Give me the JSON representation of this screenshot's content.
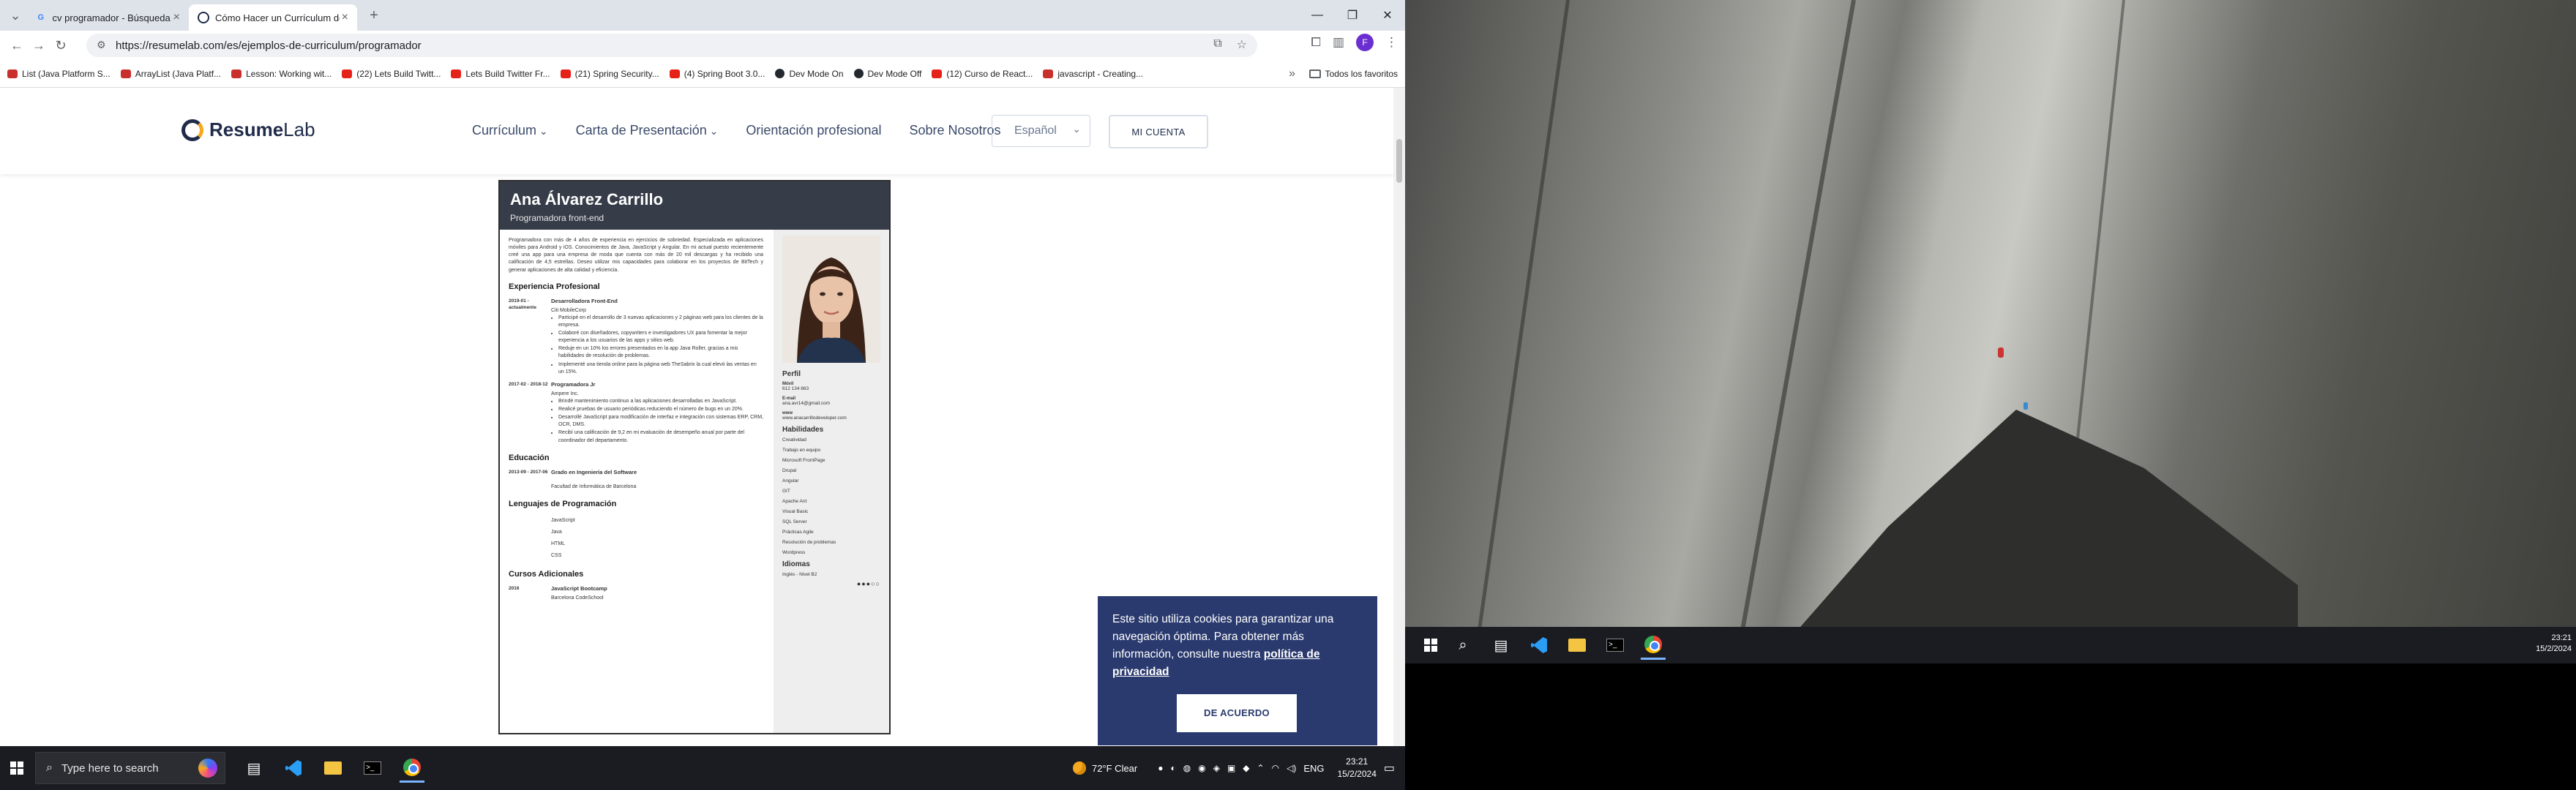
{
  "browser": {
    "tabs": [
      {
        "label": "cv programador - Búsqueda de",
        "active": false,
        "favicon": "google"
      },
      {
        "label": "Cómo Hacer un Currículum de",
        "active": true,
        "favicon": "resumelab"
      }
    ],
    "url": "https://resumelab.com/es/ejemplos-de-curriculum/programador",
    "avatar_letter": "F",
    "bookmarks": [
      {
        "label": "List (Java Platform S...",
        "icon": "doc"
      },
      {
        "label": "ArrayList (Java Platf...",
        "icon": "doc"
      },
      {
        "label": "Lesson: Working wit...",
        "icon": "doc"
      },
      {
        "label": "(22) Lets Build Twitt...",
        "icon": "yt"
      },
      {
        "label": "Lets Build Twitter Fr...",
        "icon": "yt"
      },
      {
        "label": "(21) Spring Security...",
        "icon": "yt"
      },
      {
        "label": "(4) Spring Boot 3.0...",
        "icon": "yt"
      },
      {
        "label": "Dev Mode On",
        "icon": "gh"
      },
      {
        "label": "Dev Mode Off",
        "icon": "gh"
      },
      {
        "label": "(12) Curso de React...",
        "icon": "yt"
      },
      {
        "label": "javascript - Creating...",
        "icon": "doc"
      }
    ],
    "all_bookmarks": "Todos los favoritos"
  },
  "site": {
    "logo_resume": "Resume",
    "logo_lab": "Lab",
    "nav": [
      "Currículum",
      "Carta de Presentación",
      "Orientación profesional",
      "Sobre Nosotros"
    ],
    "language": "Español",
    "account_button": "MI CUENTA"
  },
  "resume": {
    "name": "Ana Álvarez Carrillo",
    "role": "Programadora front-end",
    "summary": "Programadora con más de 4 años de experiencia en ejercicios de sobriedad. Especializada en aplicaciones móviles para Android y iOS. Conocimientos de Java, JavaScript y Angular. En mi actual puesto recientemente creé una app para una empresa de moda que cuenta con más de 20 mil descargas y ha recibido una calificación de 4,5 estrellas. Deseo utilizar mis capacidades para colaborar en los proyectos de BitTech y generar aplicaciones de alta calidad y eficiencia.",
    "sec_experience": "Experiencia Profesional",
    "jobs": [
      {
        "dates": "2019-01 - actualmente",
        "title": "Desarrolladora Front-End",
        "company": "Citi MobileCorp",
        "bullets": [
          "Participé en el desarrollo de 3 nuevas aplicaciones y 2 páginas web para los clientes de la empresa.",
          "Colaboré con diseñadores, copywriters e investigadores UX para fomentar la mejor experiencia a los usuarios de las apps y sitios web.",
          "Reduje en un 10% los errores presentados en la app Java Roller, gracias a mis habilidades de resolución de problemas.",
          "Implementé una tienda online para la página web TheSabrix la cual elevó las ventas en un 15%."
        ]
      },
      {
        "dates": "2017-02 - 2018-12",
        "title": "Programadora Jr",
        "company": "Ampere Inc.",
        "bullets": [
          "Brindé mantenimiento continuo a las aplicaciones desarrolladas en JavaScript.",
          "Realicé pruebas de usuario periódicas reduciendo el número de bugs en un 20%.",
          "Desarrollé JavaScript para modificación de interfaz e integración con sistemas ERP, CRM, OCR, DMS.",
          "Recibí una calificación de 9,2 en mi evaluación de desempeño anual por parte del coordinador del departamento."
        ]
      }
    ],
    "sec_education": "Educación",
    "education": {
      "dates": "2013-09 - 2017-06",
      "title": "Grado en Ingeniería del Software",
      "school": "Facultad de Informática de Barcelona"
    },
    "sec_languages": "Lenguajes de Programación",
    "prog_languages": [
      "JavaScript",
      "Java",
      "HTML",
      "CSS"
    ],
    "sec_courses": "Cursos Adicionales",
    "course": {
      "dates": "2016",
      "title": "JavaScript Bootcamp",
      "place": "Barcelona CodeSchool"
    },
    "side": {
      "profile_title": "Perfil",
      "phone_label": "Móvil",
      "phone": "612 134 863",
      "email_label": "E-mail",
      "email": "ana.avr14@gmail.com",
      "www_label": "www",
      "www": "www.anacarrillodeveloper.com",
      "skills_title": "Habilidades",
      "skills": [
        "Creatividad",
        "Trabajo en equipo",
        "Microsoft FrontPage",
        "Drupal",
        "Angular",
        "GIT",
        "Apache Ant",
        "Visual Basic",
        "SQL Server",
        "Prácticas Agile",
        "Resolución de problemas",
        "Wordpress"
      ],
      "languages_title": "Idiomas",
      "language_entry": "Inglés - Nivel B2"
    }
  },
  "cookie": {
    "text": "Este sitio utiliza cookies para garantizar una navegación óptima. Para obtener más información, consulte nuestra ",
    "link": "política de privacidad",
    "button": "DE ACUERDO"
  },
  "taskbar": {
    "search_placeholder": "Type here to search",
    "weather": "72°F  Clear",
    "lang": "ENG",
    "time": "23:21",
    "date": "15/2/2024"
  },
  "taskbar2": {
    "time": "23:21",
    "date": "15/2/2024"
  }
}
